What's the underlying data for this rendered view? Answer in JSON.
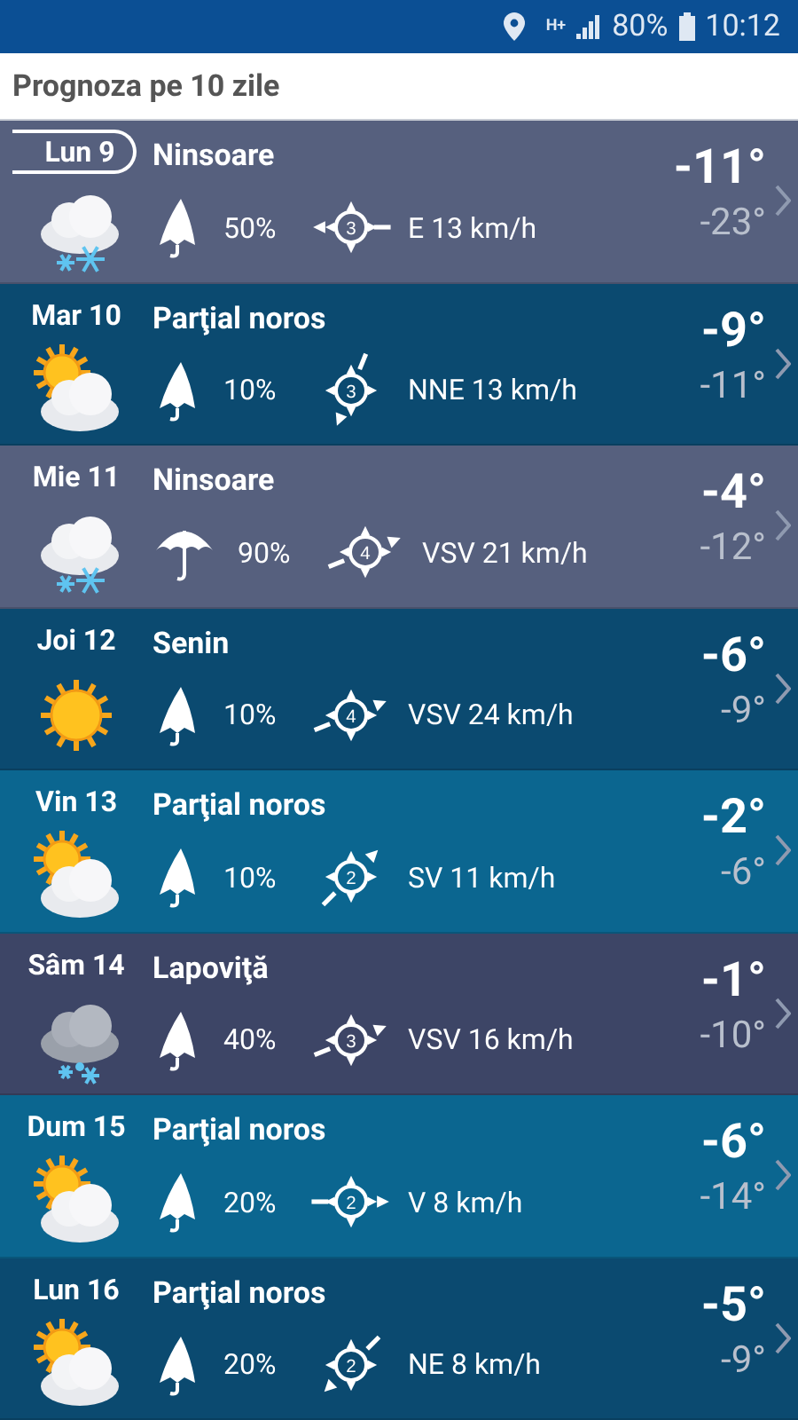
{
  "status_bar": {
    "network": "H+",
    "battery": "80%",
    "time": "10:12"
  },
  "header": {
    "title": "Prognoza pe 10 zile"
  },
  "days": [
    {
      "date": "Lun 9",
      "selected": true,
      "kind": "snow",
      "condition": "Ninsoare",
      "precip": {
        "kind": "closed",
        "value": "50%"
      },
      "wind": {
        "kind": "W",
        "force": "3",
        "text": "E 13 km/h"
      },
      "high": "-11°",
      "low": "-23°",
      "color": "#56607e"
    },
    {
      "date": "Mar 10",
      "selected": false,
      "kind": "cloudy",
      "condition": "Parţial noros",
      "precip": {
        "kind": "closed",
        "value": "10%"
      },
      "wind": {
        "kind": "SSW",
        "force": "3",
        "text": "NNE 13 km/h"
      },
      "high": "-9°",
      "low": "-11°",
      "color": "#0b4a70"
    },
    {
      "date": "Mie 11",
      "selected": false,
      "kind": "snow",
      "condition": "Ninsoare",
      "precip": {
        "kind": "open",
        "value": "90%"
      },
      "wind": {
        "kind": "ENE",
        "force": "4",
        "text": "VSV 21 km/h"
      },
      "high": "-4°",
      "low": "-12°",
      "color": "#56607e"
    },
    {
      "date": "Joi 12",
      "selected": false,
      "kind": "sunny",
      "condition": "Senin",
      "precip": {
        "kind": "closed",
        "value": "10%"
      },
      "wind": {
        "kind": "ENE",
        "force": "4",
        "text": "VSV 24 km/h"
      },
      "high": "-6°",
      "low": "-9°",
      "color": "#0b4a70"
    },
    {
      "date": "Vin 13",
      "selected": false,
      "kind": "cloudy",
      "condition": "Parţial noros",
      "precip": {
        "kind": "closed",
        "value": "10%"
      },
      "wind": {
        "kind": "NE",
        "force": "2",
        "text": "SV 11 km/h"
      },
      "high": "-2°",
      "low": "-6°",
      "color": "#0b6690"
    },
    {
      "date": "Sâm 14",
      "selected": false,
      "kind": "sleet",
      "condition": "Lapoviţă",
      "precip": {
        "kind": "closed",
        "value": "40%"
      },
      "wind": {
        "kind": "ENE",
        "force": "3",
        "text": "VSV 16 km/h"
      },
      "high": "-1°",
      "low": "-10°",
      "color": "#3d4566"
    },
    {
      "date": "Dum 15",
      "selected": false,
      "kind": "cloudy",
      "condition": "Parţial noros",
      "precip": {
        "kind": "closed",
        "value": "20%"
      },
      "wind": {
        "kind": "E",
        "force": "2",
        "text": "V 8 km/h"
      },
      "high": "-6°",
      "low": "-14°",
      "color": "#0b6690"
    },
    {
      "date": "Lun 16",
      "selected": false,
      "kind": "cloudy",
      "condition": "Parţial noros",
      "precip": {
        "kind": "closed",
        "value": "20%"
      },
      "wind": {
        "kind": "SW",
        "force": "2",
        "text": "NE 8 km/h"
      },
      "high": "-5°",
      "low": "-9°",
      "color": "#0b4a70"
    }
  ]
}
